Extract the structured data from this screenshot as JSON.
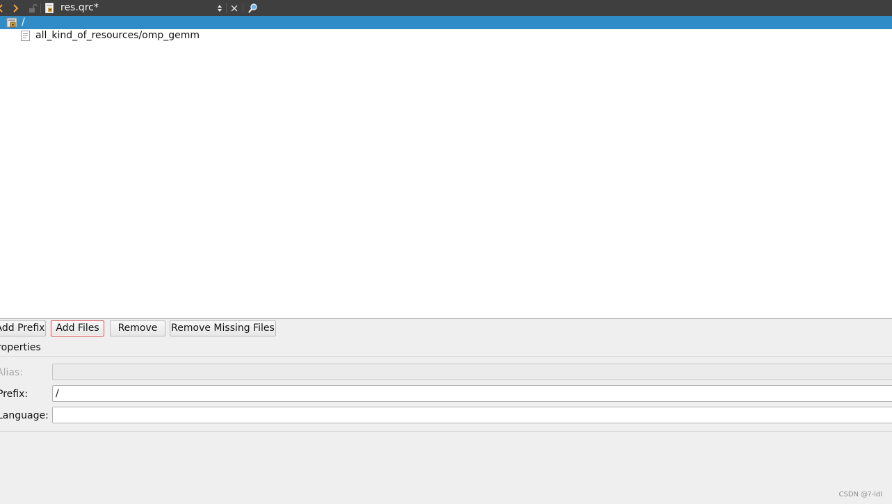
{
  "toolbar": {
    "document_title": "res.qrc*",
    "icons": {
      "back": "chevron-left-icon",
      "forward": "chevron-right-icon",
      "lock": "unlock-icon",
      "file": "qrc-file-icon",
      "split": "split-icon",
      "close": "close-icon",
      "locator": "search-icon"
    }
  },
  "tree": {
    "prefix": {
      "label": "/",
      "icon": "prefix-folder-icon",
      "selected": true
    },
    "files": [
      {
        "label": "all_kind_of_resources/omp_gemm",
        "icon": "text-file-icon"
      }
    ]
  },
  "buttons": {
    "add_prefix": "Add Prefix",
    "add_files": "Add Files",
    "remove": "Remove",
    "remove_missing": "Remove Missing Files"
  },
  "properties": {
    "title": "Properties",
    "alias": {
      "label": "Alias:",
      "value": "",
      "enabled": false
    },
    "prefix": {
      "label": "Prefix:",
      "value": "/",
      "enabled": true
    },
    "language": {
      "label": "Language:",
      "value": "",
      "enabled": true
    }
  },
  "watermark": "CSDN @?-ldl",
  "colors": {
    "toolbar_bg": "#3f3f3f",
    "selection": "#308cc6",
    "focus_border": "#d23b3b",
    "panel_bg": "#efefef"
  }
}
